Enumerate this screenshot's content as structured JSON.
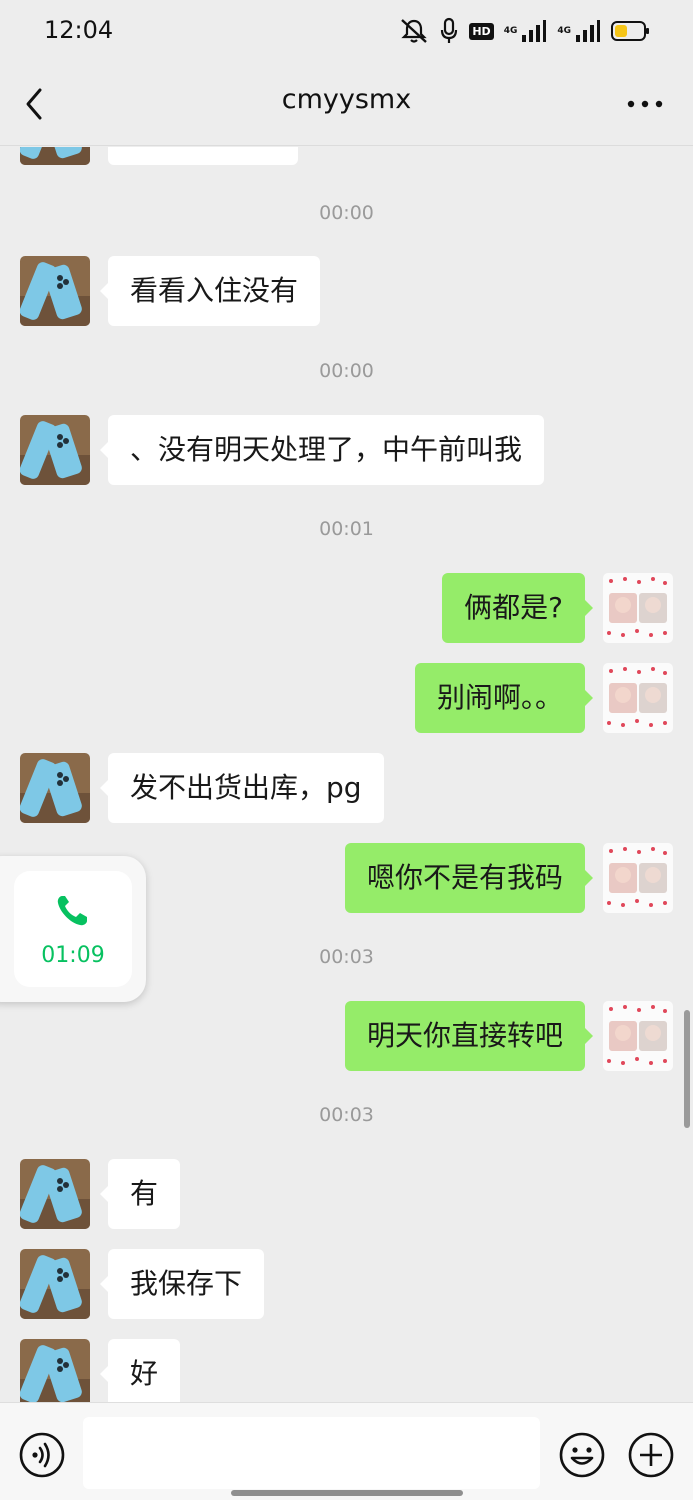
{
  "status_bar": {
    "time": "12:04",
    "hd_badge": "HD",
    "signal1_label": "4G",
    "signal2_label": "4G"
  },
  "header": {
    "title": "cmyysmx",
    "back_icon": "chevron-left-icon",
    "more_icon": "more-dots-icon"
  },
  "messages": [
    {
      "type": "incoming",
      "text": ""
    },
    {
      "type": "time",
      "text": "00:00"
    },
    {
      "type": "incoming",
      "text": "看看入住没有"
    },
    {
      "type": "time",
      "text": "00:00"
    },
    {
      "type": "incoming",
      "text": "、没有明天处理了，中午前叫我"
    },
    {
      "type": "time",
      "text": "00:01"
    },
    {
      "type": "outgoing",
      "text": "俩都是?"
    },
    {
      "type": "outgoing",
      "text": "别闹啊。。"
    },
    {
      "type": "incoming",
      "text": "发不出货出库，pg"
    },
    {
      "type": "outgoing",
      "text": "嗯你不是有我码"
    },
    {
      "type": "time",
      "text": "00:03"
    },
    {
      "type": "outgoing",
      "text": "明天你直接转吧"
    },
    {
      "type": "time",
      "text": "00:03"
    },
    {
      "type": "incoming",
      "text": "有"
    },
    {
      "type": "incoming",
      "text": "我保存下"
    },
    {
      "type": "incoming",
      "text": "好"
    }
  ],
  "call_widget": {
    "icon": "phone-icon",
    "duration": "01:09",
    "color": "#07c160"
  },
  "input_bar": {
    "placeholder": "",
    "voice_icon": "voice-icon",
    "emoji_icon": "emoji-icon",
    "plus_icon": "plus-icon"
  },
  "colors": {
    "background": "#ededed",
    "outgoing_bubble": "#95ec69",
    "incoming_bubble": "#ffffff",
    "timestamp": "#9a9a9a"
  }
}
